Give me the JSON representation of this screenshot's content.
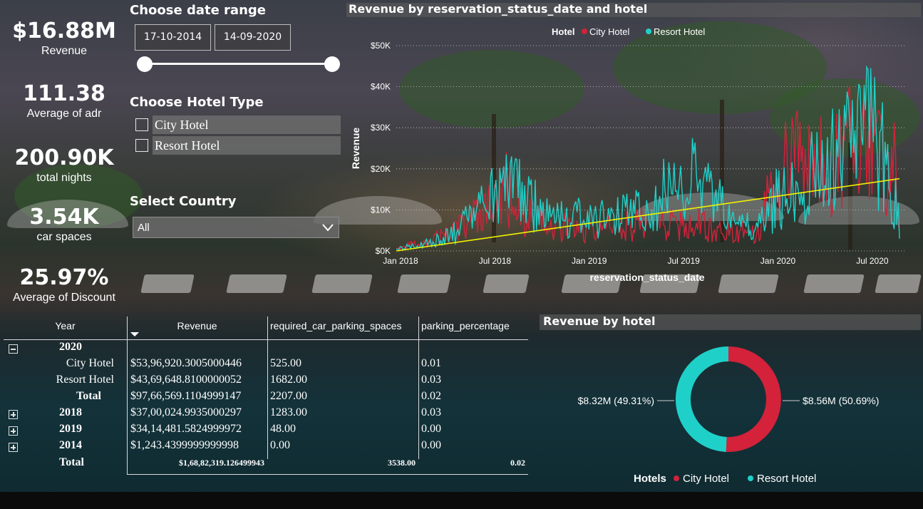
{
  "kpis": [
    {
      "value": "$16.88M",
      "label": "Revenue"
    },
    {
      "value": "111.38",
      "label": "Average of adr"
    },
    {
      "value": "200.90K",
      "label": "total nights"
    },
    {
      "value": "3.54K",
      "label": "car spaces"
    },
    {
      "value": "25.97%",
      "label": "Average of Discount"
    }
  ],
  "date_slicer": {
    "title": "Choose date range",
    "start": "17-10-2014",
    "end": "14-09-2020"
  },
  "hotel_slicer": {
    "title": "Choose Hotel Type",
    "options": [
      "City Hotel",
      "Resort Hotel"
    ]
  },
  "country_slicer": {
    "title": "Select Country",
    "value": "All"
  },
  "colors": {
    "city": "#d3223a",
    "resort": "#1fd0c9",
    "trend": "#f2f200"
  },
  "icons": {
    "dropdown": "chevron-down-icon",
    "expand": "plus-box-icon",
    "collapse": "minus-box-icon"
  },
  "chart_data": [
    {
      "type": "line",
      "title": "Revenue by reservation_status_date and hotel",
      "xlabel": "reservation_status_date",
      "ylabel": "Revenue",
      "legend_title": "Hotel",
      "legend_position": "top",
      "x_ticks": [
        "Jan 2018",
        "Jul 2018",
        "Jan 2019",
        "Jul 2019",
        "Jan 2020",
        "Jul 2020"
      ],
      "y_ticks": [
        "$0K",
        "$10K",
        "$20K",
        "$30K",
        "$40K",
        "$50K"
      ],
      "ylim": [
        0,
        50000
      ],
      "grid": true,
      "x_months": [
        "2018-01",
        "2018-02",
        "2018-03",
        "2018-04",
        "2018-05",
        "2018-06",
        "2018-07",
        "2018-08",
        "2018-09",
        "2018-10",
        "2018-11",
        "2018-12",
        "2019-01",
        "2019-02",
        "2019-03",
        "2019-04",
        "2019-05",
        "2019-06",
        "2019-07",
        "2019-08",
        "2019-09",
        "2019-10",
        "2019-11",
        "2019-12",
        "2020-01",
        "2020-02",
        "2020-03",
        "2020-04",
        "2020-05",
        "2020-06",
        "2020-07",
        "2020-08",
        "2020-09"
      ],
      "series": [
        {
          "name": "City Hotel",
          "color": "#d3223a",
          "values": [
            500,
            1500,
            2500,
            3500,
            5500,
            8000,
            10000,
            15000,
            9000,
            7000,
            5500,
            6000,
            5000,
            5000,
            6000,
            6500,
            7500,
            6500,
            6000,
            6500,
            5500,
            4500,
            6000,
            5000,
            19000,
            21000,
            22000,
            20000,
            24000,
            27000,
            25000,
            23000,
            17000
          ]
        },
        {
          "name": "Resort Hotel",
          "color": "#1fd0c9",
          "values": [
            500,
            1200,
            2000,
            3000,
            5000,
            9000,
            12000,
            16000,
            14000,
            10000,
            7000,
            8000,
            8000,
            7500,
            8000,
            9000,
            11000,
            14000,
            16000,
            17000,
            13000,
            9000,
            6000,
            5000,
            12000,
            14000,
            17000,
            19000,
            22000,
            27000,
            28000,
            25000,
            10000
          ]
        },
        {
          "name": "Trend",
          "color": "#f2f200",
          "values": [
            0,
            17600
          ],
          "trend": true
        }
      ]
    },
    {
      "type": "pie",
      "title": "Revenue by hotel",
      "legend_title": "Hotels",
      "legend_position": "bottom",
      "slices": [
        {
          "name": "City Hotel",
          "value": 8.56,
          "label": "$8.56M (50.69%)",
          "color": "#d3223a"
        },
        {
          "name": "Resort Hotel",
          "value": 8.32,
          "label": "$8.32M (49.31%)",
          "color": "#1fd0c9"
        }
      ]
    },
    {
      "type": "table",
      "columns": [
        "Year",
        "Revenue",
        "required_car_parking_spaces",
        "parking_percentage"
      ],
      "rows": [
        {
          "label": "2020",
          "level": 0,
          "expander": "minus",
          "revenue": "",
          "parking": "",
          "pct": ""
        },
        {
          "label": "City Hotel",
          "level": 1,
          "expander": "",
          "revenue": "$53,96,920.3005000446",
          "parking": "525.00",
          "pct": "0.01"
        },
        {
          "label": "Resort Hotel",
          "level": 1,
          "expander": "",
          "revenue": "$43,69,648.8100000052",
          "parking": "1682.00",
          "pct": "0.03"
        },
        {
          "label": "Total",
          "level": 1,
          "expander": "",
          "revenue": "$97,66,569.1104999147",
          "parking": "2207.00",
          "pct": "0.02"
        },
        {
          "label": "2018",
          "level": 0,
          "expander": "plus",
          "revenue": "$37,00,024.9935000297",
          "parking": "1283.00",
          "pct": "0.03"
        },
        {
          "label": "2019",
          "level": 0,
          "expander": "plus",
          "revenue": "$34,14,481.5824999972",
          "parking": "48.00",
          "pct": "0.00"
        },
        {
          "label": "2014",
          "level": 0,
          "expander": "plus",
          "revenue": "$1,243.4399999999998",
          "parking": "0.00",
          "pct": "0.00"
        }
      ],
      "total": {
        "label": "Total",
        "revenue": "$1,68,82,319.126499943",
        "parking": "3538.00",
        "pct": "0.02"
      }
    }
  ]
}
